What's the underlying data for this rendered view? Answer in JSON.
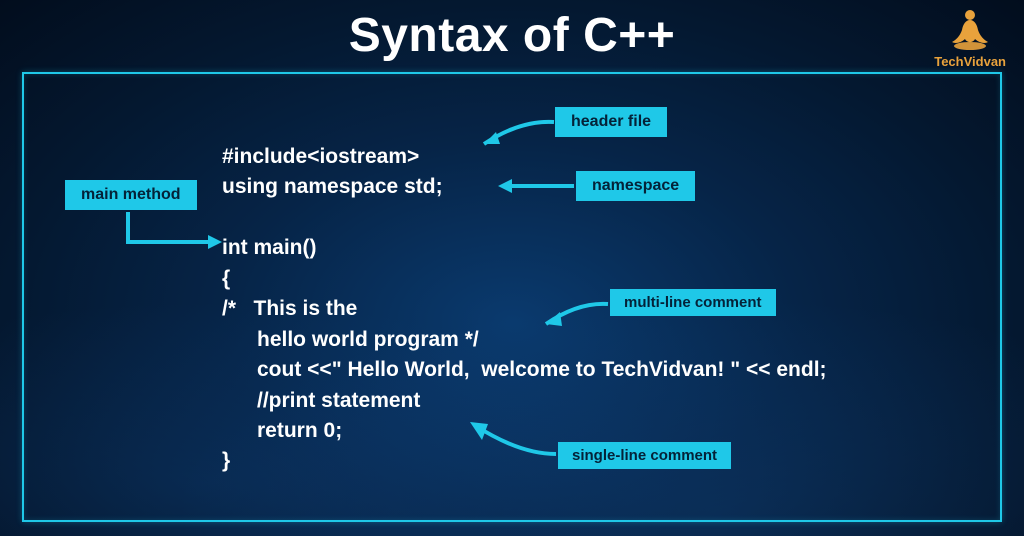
{
  "title": "Syntax of C++",
  "brand": "TechVidvan",
  "labels": {
    "header_file": "header file",
    "namespace": "namespace",
    "main_method": "main method",
    "multiline_comment": "multi-line comment",
    "singleline_comment": "single-line comment"
  },
  "code": {
    "l1": "#include<iostream>",
    "l2": "using namespace std;",
    "l3": "",
    "l4": "int main()",
    "l5": "{",
    "l6": "/*   This is the",
    "l7": "      hello world program */",
    "l8": "      cout <<\" Hello World,  welcome to TechVidvan! \" << endl;",
    "l9": "      //print statement",
    "l10": "      return 0;",
    "l11": "}"
  }
}
